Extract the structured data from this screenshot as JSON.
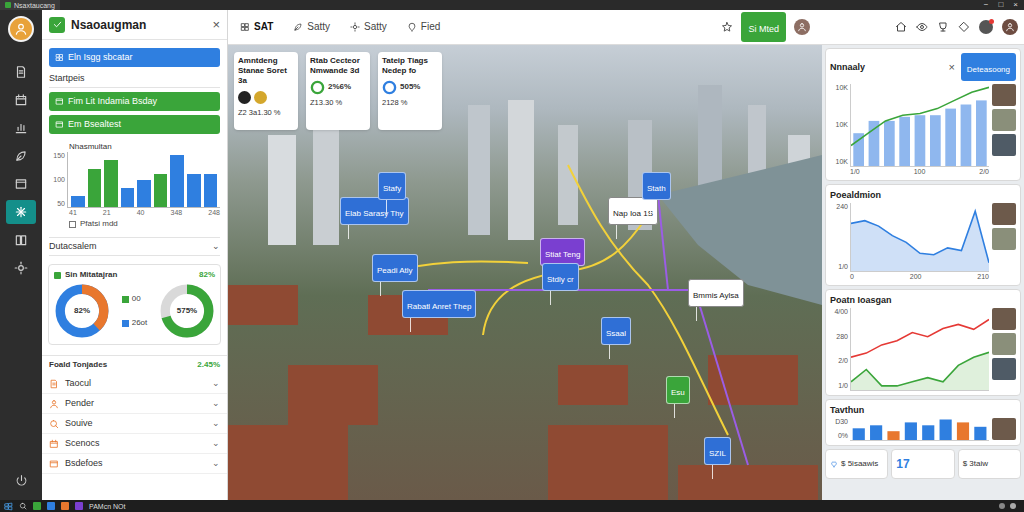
{
  "browser": {
    "tab_title": "Nsaxtaucang",
    "controls": [
      "−",
      "□",
      "×"
    ]
  },
  "rail": [
    {
      "selected": false
    },
    {
      "selected": false
    },
    {
      "selected": false
    },
    {
      "selected": false
    },
    {
      "selected": false
    },
    {
      "selected": true
    },
    {
      "selected": false
    },
    {
      "selected": false
    }
  ],
  "panel": {
    "title": "Nsaoaugman",
    "close": "×",
    "primary_button": "Eln Isgg sbcatar",
    "section": "Startpeis",
    "buttons": [
      "Fim Lit Indamia Bsday",
      "Em Bsealtest"
    ],
    "chart": {
      "title": "Nhasmultan",
      "y_ticks": [
        "150",
        "100",
        "50"
      ],
      "x_ticks": [
        "41",
        "21",
        "40",
        "348",
        "248"
      ],
      "bars": [
        {
          "value": 30,
          "color": "#2f7fe0"
        },
        {
          "value": 105,
          "color": "#3aa53a"
        },
        {
          "value": 128,
          "color": "#3aa53a"
        },
        {
          "value": 52,
          "color": "#2f7fe0"
        },
        {
          "value": 75,
          "color": "#2f7fe0"
        },
        {
          "value": 90,
          "color": "#3aa53a"
        },
        {
          "value": 142,
          "color": "#2f7fe0"
        },
        {
          "value": 90,
          "color": "#2f7fe0"
        },
        {
          "value": 90,
          "color": "#2f7fe0"
        }
      ],
      "legend": "Pfatsi mdd",
      "legend_checked": false
    },
    "dropdown": {
      "label": "Dutacsalem",
      "caret": "⌄"
    },
    "donut_card": {
      "title": "Sin Mitatajran",
      "value": "82%",
      "legend": [
        {
          "label": "00",
          "color": "#3aa53a"
        },
        {
          "label": "26ot",
          "color": "#2f7fe0"
        }
      ],
      "donuts": [
        {
          "label": "82%",
          "level": 0.38,
          "color": "#e8772e",
          "track": "#2f7fe0"
        },
        {
          "label": "575%",
          "level": 0.7,
          "color": "#3aa53a",
          "track": "#d9d9d9"
        }
      ]
    },
    "list": {
      "title": "Foald Tonjades",
      "value": "2.45%",
      "caret": "⌄",
      "items": [
        "Taocul",
        "Pender",
        "Souive",
        "Scenocs",
        "Bsdefoes"
      ]
    }
  },
  "nav": {
    "items": [
      {
        "label": "SAT",
        "selected": true
      },
      {
        "label": "Satty",
        "selected": false
      },
      {
        "label": "Satty",
        "selected": false
      },
      {
        "label": "Fied",
        "selected": false
      }
    ],
    "button": "Si Mted"
  },
  "stats": [
    {
      "title": "Amntdeng Stanae Soret 3a",
      "kind": "coins",
      "color": "#d4a72c",
      "value": "Z2 3a1.30 %"
    },
    {
      "title": "Rtab Cecteor Nmwande 3d",
      "kind": "ring",
      "color": "#3aa53a",
      "badge": "2%6%",
      "value": "Z13.30 %"
    },
    {
      "title": "Tateip Tiags Nedep fo",
      "kind": "ring",
      "color": "#2f7fe0",
      "badge": "505%",
      "value": "2128 %"
    }
  ],
  "map": {
    "pins": [
      {
        "label": "Elab Sarasy Thy",
        "color": "#2f6fd6"
      },
      {
        "label": "Stafy",
        "color": "#2f6fd6"
      },
      {
        "label": "Peadi Atly",
        "color": "#2f6fd6"
      },
      {
        "label": "Rabatl Anret Thep",
        "color": "#2f6fd6"
      },
      {
        "label": "Stiat Teng",
        "color": "#7a3fd0"
      },
      {
        "label": "Stdly cr",
        "color": "#2f6fd6"
      },
      {
        "label": "Ssaal",
        "color": "#2f6fd6"
      },
      {
        "label": "Nap Ioa 1S",
        "color": "#ffffff"
      },
      {
        "label": "Stath",
        "color": "#2f6fd6"
      },
      {
        "label": "Bmmis Aylsa",
        "color": "#ffffff"
      },
      {
        "label": "Esu",
        "color": "#3aa53a"
      },
      {
        "label": "SZIL",
        "color": "#2f6fd6"
      }
    ]
  },
  "right": {
    "analytics": {
      "title": "Nnnaaly",
      "close": "×",
      "button": "Deteasoong",
      "y_ticks": [
        "10K",
        "10K",
        "10K"
      ],
      "x_ticks": [
        "1/0",
        "100",
        "2/0"
      ],
      "bars": [
        40,
        55,
        55,
        60,
        62,
        62,
        70,
        75,
        80
      ],
      "line": [
        25,
        40,
        55,
        62,
        64,
        70,
        80,
        90,
        96
      ]
    },
    "population": {
      "title": "Poealdmion",
      "y_ticks": [
        "240",
        "1/0"
      ],
      "x_ticks": [
        "0",
        "200",
        "210"
      ],
      "series": [
        70,
        74,
        66,
        52,
        42,
        26,
        24,
        34,
        30,
        88,
        12
      ]
    },
    "location": {
      "title": "Poatn Ioasgan",
      "y_ticks": [
        "4/00",
        "280",
        "2/0",
        "1/0"
      ],
      "series": [
        {
          "values": [
            40,
            45,
            55,
            60,
            70,
            65,
            75,
            80,
            74,
            86
          ],
          "color": "#e53935"
        },
        {
          "values": [
            10,
            25,
            5,
            5,
            10,
            15,
            10,
            30,
            40,
            46
          ],
          "color": "#3aa53a"
        }
      ]
    },
    "tavthun": {
      "title": "Tavthun",
      "y_ticks": [
        "D30",
        "0%"
      ],
      "bars": [
        {
          "value": 8,
          "color": "#2f7fe0"
        },
        {
          "value": 10,
          "color": "#2f7fe0"
        },
        {
          "value": 6,
          "color": "#e8772e"
        },
        {
          "value": 12,
          "color": "#2f7fe0"
        },
        {
          "value": 10,
          "color": "#2f7fe0"
        },
        {
          "value": 14,
          "color": "#2f7fe0"
        },
        {
          "value": 12,
          "color": "#e8772e"
        },
        {
          "value": 9,
          "color": "#2f7fe0"
        }
      ]
    },
    "minicards": [
      {
        "text": "$ 5isaawis",
        "kind": "icon-label"
      },
      {
        "text": "17",
        "kind": "number"
      },
      {
        "text": "$ 3taiw",
        "kind": "label"
      }
    ]
  },
  "taskbar": {
    "label": "PAMcn NOt"
  }
}
